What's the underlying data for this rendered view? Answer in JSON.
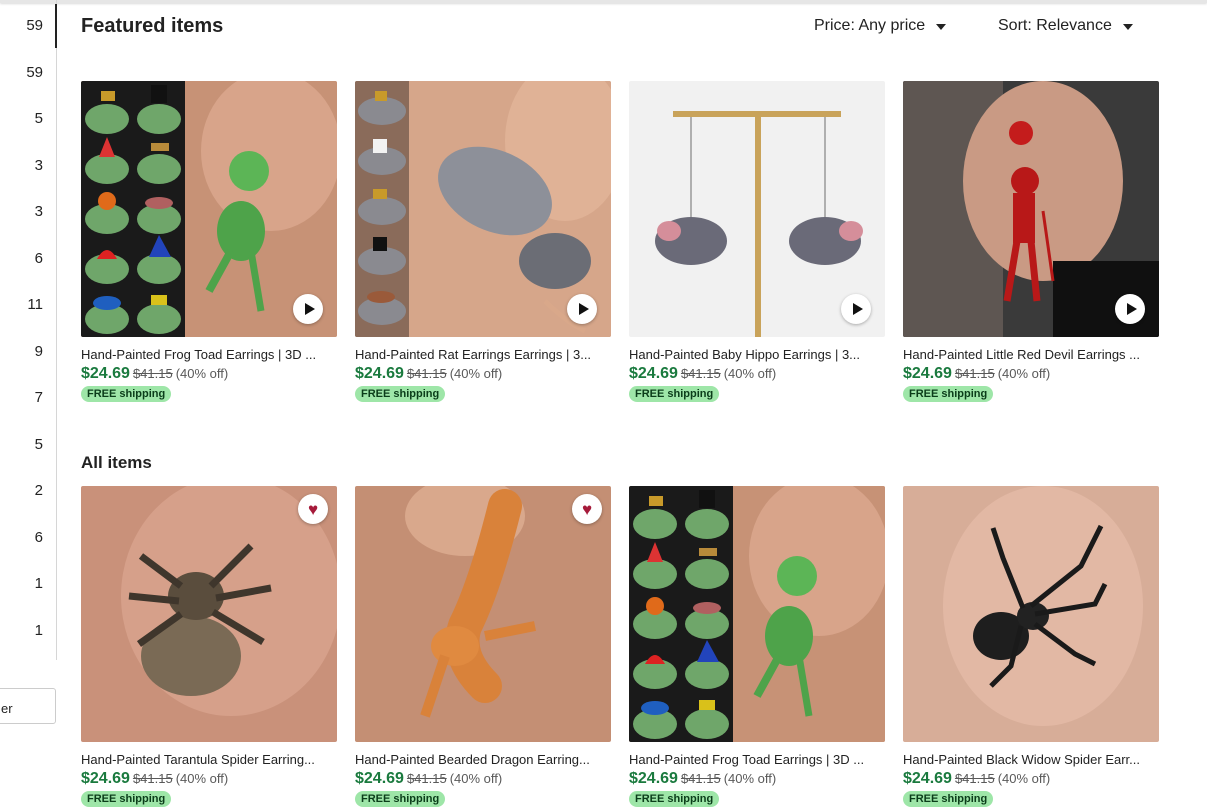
{
  "sidebar": {
    "counts": [
      "59",
      "59",
      "5",
      "3",
      "3",
      "6",
      "11",
      "9",
      "7",
      "5",
      "2",
      "6",
      "1",
      "1"
    ],
    "filter_label": "er"
  },
  "featured": {
    "title": "Featured items",
    "price_filter": "Price: Any price",
    "sort": "Sort: Relevance",
    "items": [
      {
        "title": "Hand-Painted Frog Toad Earrings | 3D ...",
        "price": "$24.69",
        "original": "$41.15",
        "discount": "(40% off)",
        "shipping": "FREE shipping",
        "video": true,
        "favorited": false,
        "image": "frog-earring"
      },
      {
        "title": "Hand-Painted Rat Earrings Earrings | 3...",
        "price": "$24.69",
        "original": "$41.15",
        "discount": "(40% off)",
        "shipping": "FREE shipping",
        "video": true,
        "favorited": false,
        "image": "rat-earring"
      },
      {
        "title": "Hand-Painted Baby Hippo Earrings | 3...",
        "price": "$24.69",
        "original": "$41.15",
        "discount": "(40% off)",
        "shipping": "FREE shipping",
        "video": true,
        "favorited": false,
        "image": "hippo-earring"
      },
      {
        "title": "Hand-Painted Little Red Devil Earrings ...",
        "price": "$24.69",
        "original": "$41.15",
        "discount": "(40% off)",
        "shipping": "FREE shipping",
        "video": true,
        "favorited": false,
        "image": "devil-earring"
      }
    ]
  },
  "all": {
    "title": "All items",
    "items": [
      {
        "title": "Hand-Painted Tarantula Spider Earring...",
        "price": "$24.69",
        "original": "$41.15",
        "discount": "(40% off)",
        "shipping": "FREE shipping",
        "video": false,
        "favorited": true,
        "image": "tarantula-earring"
      },
      {
        "title": "Hand-Painted Bearded Dragon Earring...",
        "price": "$24.69",
        "original": "$41.15",
        "discount": "(40% off)",
        "shipping": "FREE shipping",
        "video": false,
        "favorited": true,
        "image": "dragon-earring"
      },
      {
        "title": "Hand-Painted Frog Toad Earrings | 3D ...",
        "price": "$24.69",
        "original": "$41.15",
        "discount": "(40% off)",
        "shipping": "FREE shipping",
        "video": false,
        "favorited": false,
        "image": "frog-earring"
      },
      {
        "title": "Hand-Painted Black Widow Spider Earr...",
        "price": "$24.69",
        "original": "$41.15",
        "discount": "(40% off)",
        "shipping": "FREE shipping",
        "video": false,
        "favorited": false,
        "image": "widow-earring"
      }
    ]
  },
  "colors": {
    "price": "#1a7a3e",
    "badge_bg": "#9ee6a8",
    "heart": "#a61a3a"
  }
}
